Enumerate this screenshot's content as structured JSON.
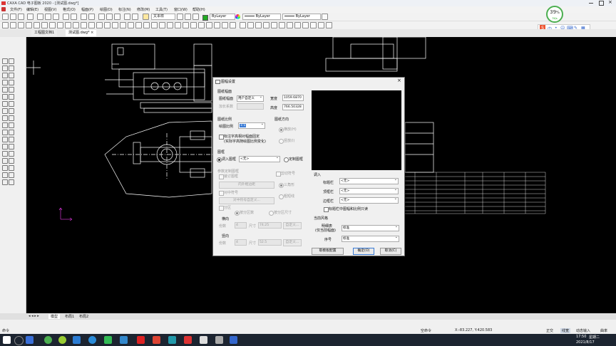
{
  "window": {
    "title": "CAXA CAD 电子图板 2020 - [测试图.dwg*]"
  },
  "menu": [
    "文件(F)",
    "编辑(E)",
    "视图(V)",
    "格式(O)",
    "幅面(P)",
    "绘图(D)",
    "标注(N)",
    "修改(M)",
    "工具(T)",
    "窗口(W)",
    "帮助(H)"
  ],
  "toolbar": {
    "text_style": "文本样",
    "layer": "ByLayer",
    "linetype": "ByLayer",
    "lineweight": "ByLayer"
  },
  "doc_tabs": [
    "工程图文档1",
    "测试图.dwg*"
  ],
  "layout_tabs": [
    "模型",
    "布局1",
    "布局2"
  ],
  "badge": {
    "percent": "39",
    "unit": "%",
    "sub": "7K/s"
  },
  "ime_icons": [
    "S",
    "中",
    "•",
    "☺",
    "⌨",
    "✎",
    "▦"
  ],
  "status": {
    "cmd": "命令",
    "mode": "空命令",
    "coords": "X:-83.227, Y:420.583",
    "items": [
      "正交",
      "线宽",
      "动态输入",
      "曲率"
    ]
  },
  "clock": {
    "time": "17:50",
    "weekday": "星期二",
    "date": "2021/8/17"
  },
  "dialog": {
    "title": "图幅设置",
    "close": "×",
    "paper_size": {
      "group": "图纸幅面",
      "label": "图纸幅面",
      "value": "用户自定义",
      "scale_label": "加长系数",
      "width_label": "宽度",
      "width_value": "1059.6870",
      "height_label": "高度",
      "height_value": "766.50328"
    },
    "drawing_scale": {
      "group": "图纸比例",
      "label": "绘图比例",
      "value": "1:1",
      "check_label_1": "标注字高相对幅面固定",
      "check_label_2": "(实际字高随绘图比例变化)"
    },
    "orientation": {
      "group": "图纸方向",
      "landscape": "横放(H)",
      "portrait": "竖放(I)"
    },
    "frame": {
      "group": "图框",
      "call_frame": "调入图框",
      "call_value": "<无>",
      "custom_frame": "定制图框"
    },
    "params": {
      "group": "参数定制图框",
      "binding": "装订图框",
      "inner_edge": "内外框边距",
      "mark": "对中符号",
      "mark_btn": "对中符号自定义...",
      "cut_mark": "剪切符号",
      "triangle": "三角形",
      "thick_line": "粗短线",
      "zone": "分区",
      "by_count": "按分区数",
      "by_size": "按分区尺寸",
      "horiz": "横向",
      "vert": "竖向",
      "count_label": "份数",
      "count_value": "4",
      "size_label": "尺寸",
      "h_size": "74.25",
      "v_size": "52.5",
      "custom_btn": "自定义..."
    },
    "call": {
      "group": "调入",
      "title_bar": "标题栏",
      "title_bar_value": "<无>",
      "top_bar": "顶框栏",
      "top_bar_value": "<无>",
      "side_bar": "边框栏",
      "side_bar_value": "<无>",
      "check": "标题栏中图幅和比例只读"
    },
    "style": {
      "group": "当前风格",
      "detail_label": "明细表",
      "detail_sub": "(仅当前幅面)",
      "detail_value": "标准",
      "seq_label": "序号",
      "seq_value": "标准"
    },
    "buttons": {
      "template": "取模板配置",
      "ok": "确定(O)",
      "cancel": "取消(C)"
    }
  }
}
